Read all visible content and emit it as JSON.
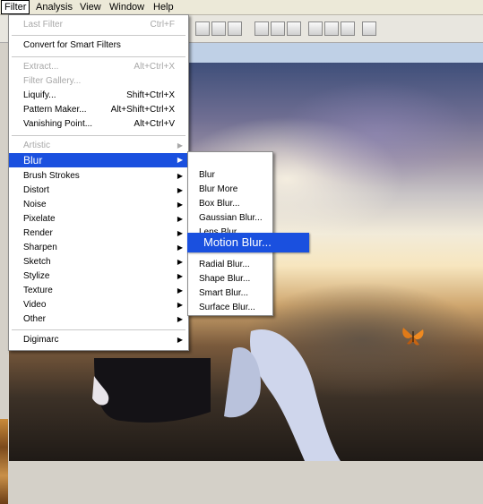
{
  "menubar": {
    "items": [
      "Filter",
      "Analysis",
      "View",
      "Window",
      "Help"
    ]
  },
  "filter_menu": {
    "items": [
      {
        "label": "Last Filter",
        "shortcut": "Ctrl+F",
        "disabled": true
      },
      {
        "label": "Convert for Smart Filters"
      },
      {
        "label": "Extract...",
        "shortcut": "Alt+Ctrl+X",
        "disabled": true
      },
      {
        "label": "Filter Gallery...",
        "disabled": true
      },
      {
        "label": "Liquify...",
        "shortcut": "Shift+Ctrl+X"
      },
      {
        "label": "Pattern Maker...",
        "shortcut": "Alt+Shift+Ctrl+X"
      },
      {
        "label": "Vanishing Point...",
        "shortcut": "Alt+Ctrl+V"
      },
      {
        "label": "Artistic",
        "disabled": true
      },
      {
        "label": "Blur",
        "selected": true
      },
      {
        "label": "Brush Strokes"
      },
      {
        "label": "Distort"
      },
      {
        "label": "Noise"
      },
      {
        "label": "Pixelate"
      },
      {
        "label": "Render"
      },
      {
        "label": "Sharpen"
      },
      {
        "label": "Sketch"
      },
      {
        "label": "Stylize"
      },
      {
        "label": "Texture"
      },
      {
        "label": "Video"
      },
      {
        "label": "Other"
      },
      {
        "label": "Digimarc"
      }
    ]
  },
  "blur_submenu": {
    "items": [
      "Blur",
      "Blur More",
      "Box Blur...",
      "Gaussian Blur...",
      "Lens Blur...",
      "Motion Blur...",
      "Radial Blur...",
      "Shape Blur...",
      "Smart Blur...",
      "Surface Blur..."
    ],
    "highlighted": "Motion Blur..."
  },
  "colors": {
    "highlight": "#1a50df",
    "menu_bg": "#ffffff",
    "disabled_text": "#a8a8a8"
  }
}
